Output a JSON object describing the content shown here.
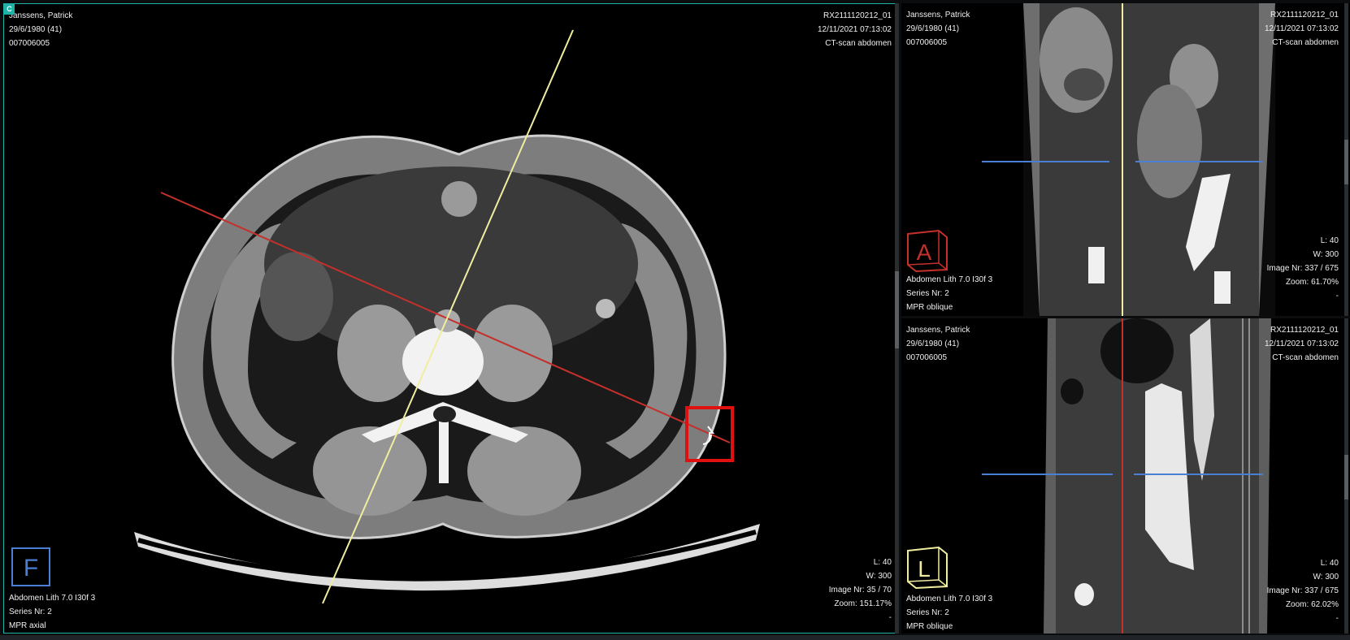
{
  "app": {
    "accent_color": "#1fb3a8"
  },
  "viewports": {
    "main": {
      "badge": "C",
      "patient": {
        "name": "Janssens, Patrick",
        "dob": "29/6/1980 (41)",
        "id": "007006005"
      },
      "study": {
        "accession": "RX2111120212_01",
        "datetime": "12/11/2021 07:13:02",
        "description": "CT-scan abdomen"
      },
      "window": {
        "level": "L: 40",
        "width": "W: 300",
        "image_nr": "Image Nr: 35 / 70",
        "zoom": "Zoom: 151.17%",
        "extra": "-"
      },
      "series": {
        "protocol": "Abdomen Lith 7.0 I30f 3",
        "series_nr": "Series Nr: 2",
        "type": "MPR axial"
      },
      "orientation": {
        "letter": "F",
        "icon": "orientation-cube-icon",
        "color": "#4a7fd4"
      },
      "crosshair": {
        "line1_color": "#c4302b",
        "line2_color": "#f1eda0"
      },
      "rotate_handle": {
        "icon": "rotate-handle-icon",
        "color": "#e01010"
      }
    },
    "top_right": {
      "patient": {
        "name": "Janssens, Patrick",
        "dob": "29/6/1980 (41)",
        "id": "007006005"
      },
      "study": {
        "accession": "RX2111120212_01",
        "datetime": "12/11/2021 07:13:02",
        "description": "CT-scan abdomen"
      },
      "window": {
        "level": "L: 40",
        "width": "W: 300",
        "image_nr": "Image Nr: 337 / 675",
        "zoom": "Zoom: 61.70%",
        "extra": "-"
      },
      "series": {
        "protocol": "Abdomen Lith 7.0 I30f 3",
        "series_nr": "Series Nr: 2",
        "type": "MPR oblique"
      },
      "orientation": {
        "letter": "A",
        "icon": "orientation-cube-icon",
        "color": "#c4302b"
      },
      "crosshair": {
        "vertical_color": "#f1eda0",
        "horizontal_color": "#4a7fd4"
      }
    },
    "bottom_right": {
      "patient": {
        "name": "Janssens, Patrick",
        "dob": "29/6/1980 (41)",
        "id": "007006005"
      },
      "study": {
        "accession": "RX2111120212_01",
        "datetime": "12/11/2021 07:13:02",
        "description": "CT-scan abdomen"
      },
      "window": {
        "level": "L: 40",
        "width": "W: 300",
        "image_nr": "Image Nr: 337 / 675",
        "zoom": "Zoom: 62.02%",
        "extra": "-"
      },
      "series": {
        "protocol": "Abdomen Lith 7.0 I30f 3",
        "series_nr": "Series Nr: 2",
        "type": "MPR oblique"
      },
      "orientation": {
        "letter": "L",
        "icon": "orientation-cube-icon",
        "color": "#f1eda0"
      },
      "crosshair": {
        "vertical_color": "#c4302b",
        "horizontal_color": "#4a7fd4"
      }
    }
  }
}
